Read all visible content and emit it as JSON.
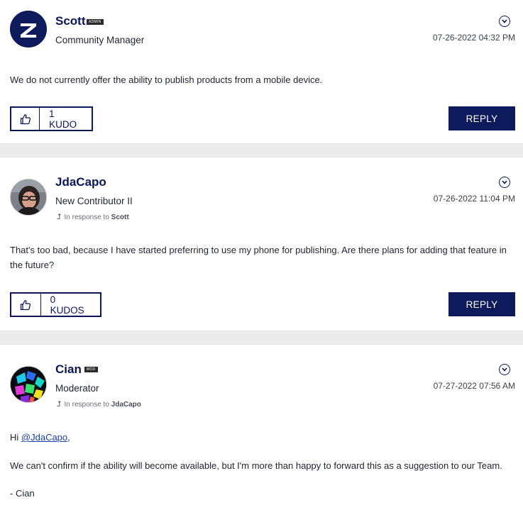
{
  "posts": [
    {
      "author": "Scott",
      "badge": "ADMIN",
      "rank": "Community Manager",
      "datetime": "07-26-2022 04:32 PM",
      "body": "We do not currently offer the ability to publish products from a mobile device.",
      "kudos_label": "1 KUDO",
      "reply_label": "REPLY"
    },
    {
      "author": "JdaCapo",
      "rank": "New Contributor II",
      "in_response_prefix": "In response to",
      "in_response_to": "Scott",
      "datetime": "07-26-2022 11:04 PM",
      "body": "That's too bad, because I have started preferring to use my phone for publishing. Are there plans for adding that feature in the future?",
      "kudos_label": "0 KUDOS",
      "reply_label": "REPLY"
    },
    {
      "author": "Cian",
      "badge": "MOD",
      "rank": "Moderator",
      "in_response_prefix": "In response to",
      "in_response_to": "JdaCapo",
      "datetime": "07-27-2022 07:56 AM",
      "greeting_prefix": "Hi",
      "mention": "@JdaCapo",
      "greeting_suffix": ",",
      "body_line2": "We can't confirm if the ability will become available, but I'm more than happy to forward this as a suggestion to our Team.",
      "signature": "- Cian"
    }
  ],
  "colors": {
    "brand_navy": "#0d1a5c",
    "page_bg": "#ebebeb",
    "card_bg": "#ffffff"
  },
  "icons": {
    "options": "chevron-circle-icon",
    "kudo": "thumbs-up-icon",
    "in_response": "reply-arrow-icon"
  }
}
